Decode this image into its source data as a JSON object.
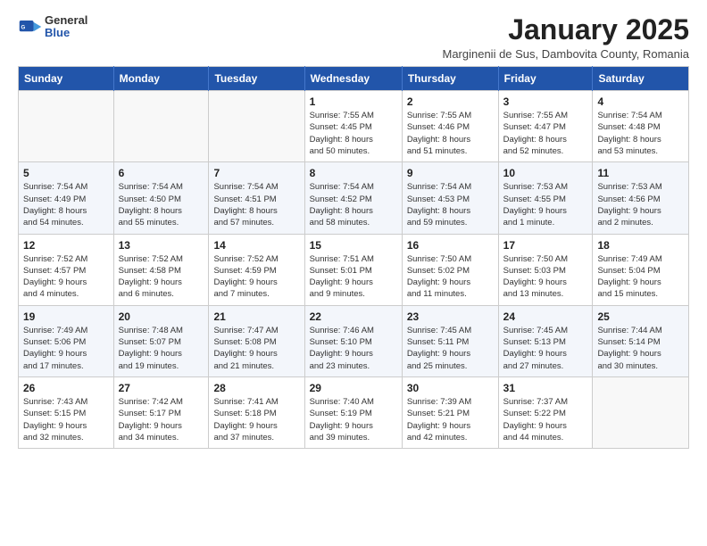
{
  "header": {
    "logo_general": "General",
    "logo_blue": "Blue",
    "month": "January 2025",
    "location": "Marginenii de Sus, Dambovita County, Romania"
  },
  "days_of_week": [
    "Sunday",
    "Monday",
    "Tuesday",
    "Wednesday",
    "Thursday",
    "Friday",
    "Saturday"
  ],
  "weeks": [
    [
      {
        "num": "",
        "info": ""
      },
      {
        "num": "",
        "info": ""
      },
      {
        "num": "",
        "info": ""
      },
      {
        "num": "1",
        "info": "Sunrise: 7:55 AM\nSunset: 4:45 PM\nDaylight: 8 hours\nand 50 minutes."
      },
      {
        "num": "2",
        "info": "Sunrise: 7:55 AM\nSunset: 4:46 PM\nDaylight: 8 hours\nand 51 minutes."
      },
      {
        "num": "3",
        "info": "Sunrise: 7:55 AM\nSunset: 4:47 PM\nDaylight: 8 hours\nand 52 minutes."
      },
      {
        "num": "4",
        "info": "Sunrise: 7:54 AM\nSunset: 4:48 PM\nDaylight: 8 hours\nand 53 minutes."
      }
    ],
    [
      {
        "num": "5",
        "info": "Sunrise: 7:54 AM\nSunset: 4:49 PM\nDaylight: 8 hours\nand 54 minutes."
      },
      {
        "num": "6",
        "info": "Sunrise: 7:54 AM\nSunset: 4:50 PM\nDaylight: 8 hours\nand 55 minutes."
      },
      {
        "num": "7",
        "info": "Sunrise: 7:54 AM\nSunset: 4:51 PM\nDaylight: 8 hours\nand 57 minutes."
      },
      {
        "num": "8",
        "info": "Sunrise: 7:54 AM\nSunset: 4:52 PM\nDaylight: 8 hours\nand 58 minutes."
      },
      {
        "num": "9",
        "info": "Sunrise: 7:54 AM\nSunset: 4:53 PM\nDaylight: 8 hours\nand 59 minutes."
      },
      {
        "num": "10",
        "info": "Sunrise: 7:53 AM\nSunset: 4:55 PM\nDaylight: 9 hours\nand 1 minute."
      },
      {
        "num": "11",
        "info": "Sunrise: 7:53 AM\nSunset: 4:56 PM\nDaylight: 9 hours\nand 2 minutes."
      }
    ],
    [
      {
        "num": "12",
        "info": "Sunrise: 7:52 AM\nSunset: 4:57 PM\nDaylight: 9 hours\nand 4 minutes."
      },
      {
        "num": "13",
        "info": "Sunrise: 7:52 AM\nSunset: 4:58 PM\nDaylight: 9 hours\nand 6 minutes."
      },
      {
        "num": "14",
        "info": "Sunrise: 7:52 AM\nSunset: 4:59 PM\nDaylight: 9 hours\nand 7 minutes."
      },
      {
        "num": "15",
        "info": "Sunrise: 7:51 AM\nSunset: 5:01 PM\nDaylight: 9 hours\nand 9 minutes."
      },
      {
        "num": "16",
        "info": "Sunrise: 7:50 AM\nSunset: 5:02 PM\nDaylight: 9 hours\nand 11 minutes."
      },
      {
        "num": "17",
        "info": "Sunrise: 7:50 AM\nSunset: 5:03 PM\nDaylight: 9 hours\nand 13 minutes."
      },
      {
        "num": "18",
        "info": "Sunrise: 7:49 AM\nSunset: 5:04 PM\nDaylight: 9 hours\nand 15 minutes."
      }
    ],
    [
      {
        "num": "19",
        "info": "Sunrise: 7:49 AM\nSunset: 5:06 PM\nDaylight: 9 hours\nand 17 minutes."
      },
      {
        "num": "20",
        "info": "Sunrise: 7:48 AM\nSunset: 5:07 PM\nDaylight: 9 hours\nand 19 minutes."
      },
      {
        "num": "21",
        "info": "Sunrise: 7:47 AM\nSunset: 5:08 PM\nDaylight: 9 hours\nand 21 minutes."
      },
      {
        "num": "22",
        "info": "Sunrise: 7:46 AM\nSunset: 5:10 PM\nDaylight: 9 hours\nand 23 minutes."
      },
      {
        "num": "23",
        "info": "Sunrise: 7:45 AM\nSunset: 5:11 PM\nDaylight: 9 hours\nand 25 minutes."
      },
      {
        "num": "24",
        "info": "Sunrise: 7:45 AM\nSunset: 5:13 PM\nDaylight: 9 hours\nand 27 minutes."
      },
      {
        "num": "25",
        "info": "Sunrise: 7:44 AM\nSunset: 5:14 PM\nDaylight: 9 hours\nand 30 minutes."
      }
    ],
    [
      {
        "num": "26",
        "info": "Sunrise: 7:43 AM\nSunset: 5:15 PM\nDaylight: 9 hours\nand 32 minutes."
      },
      {
        "num": "27",
        "info": "Sunrise: 7:42 AM\nSunset: 5:17 PM\nDaylight: 9 hours\nand 34 minutes."
      },
      {
        "num": "28",
        "info": "Sunrise: 7:41 AM\nSunset: 5:18 PM\nDaylight: 9 hours\nand 37 minutes."
      },
      {
        "num": "29",
        "info": "Sunrise: 7:40 AM\nSunset: 5:19 PM\nDaylight: 9 hours\nand 39 minutes."
      },
      {
        "num": "30",
        "info": "Sunrise: 7:39 AM\nSunset: 5:21 PM\nDaylight: 9 hours\nand 42 minutes."
      },
      {
        "num": "31",
        "info": "Sunrise: 7:37 AM\nSunset: 5:22 PM\nDaylight: 9 hours\nand 44 minutes."
      },
      {
        "num": "",
        "info": ""
      }
    ]
  ]
}
